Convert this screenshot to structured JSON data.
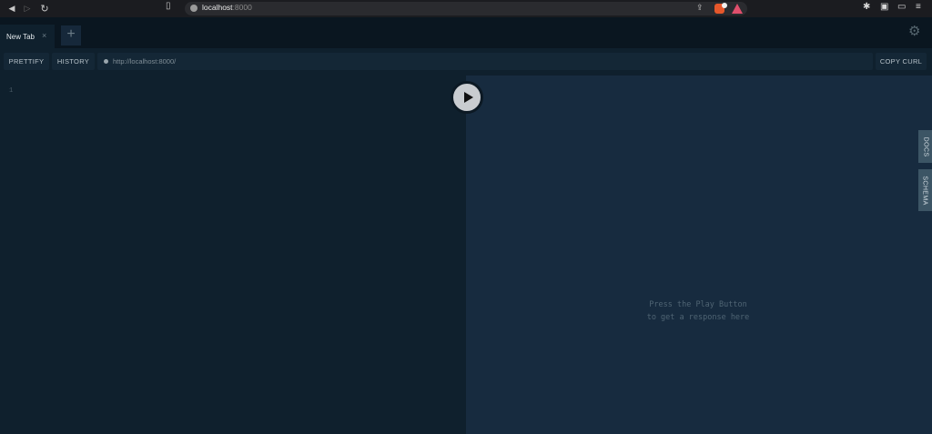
{
  "browser": {
    "url_host": "localhost",
    "url_port": ":8000"
  },
  "tabs": [
    {
      "label": "New Tab",
      "close": "×"
    }
  ],
  "tab_add": "+",
  "toolbar": {
    "prettify_label": "PRETTIFY",
    "history_label": "HISTORY",
    "endpoint_url": "http://localhost:8000/",
    "copy_curl_label": "COPY CURL"
  },
  "editor": {
    "line_number": "1"
  },
  "result": {
    "hint_line1": "Press the Play Button",
    "hint_line2": "to get a response here"
  },
  "side_tabs": {
    "docs": "DOCS",
    "schema": "SCHEMA"
  },
  "icons": {
    "back": "back-arrow-icon",
    "forward": "forward-arrow-icon",
    "reload": "reload-icon",
    "bookmark": "bookmark-icon",
    "settings": "gear-icon",
    "play": "play-icon"
  },
  "colors": {
    "editor_bg": "#0f202d",
    "result_bg": "#172b3f",
    "side_tab_bg": "#3c5565"
  }
}
